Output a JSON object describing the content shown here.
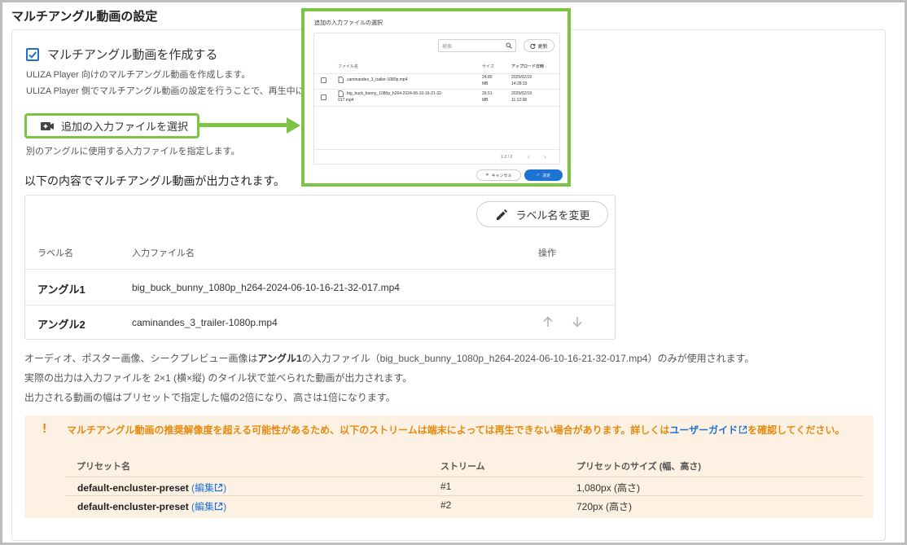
{
  "page": {
    "title": "マルチアングル動画の設定"
  },
  "settings": {
    "checkbox_label": "マルチアングル動画を作成する",
    "checkbox_checked": true,
    "hint1": "ULIZA Player 向けのマルチアングル動画を作成します。",
    "hint2": "ULIZA Player 側でマルチアングル動画の設定を行うことで、再生中に",
    "select_button_label": "追加の入力ファイルを選択",
    "select_hint": "別のアングルに使用する入力ファイルを指定します。",
    "section_title": "以下の内容でマルチアングル動画が出力されます。"
  },
  "angle_table": {
    "rename_button": "ラベル名を変更",
    "headers": {
      "label": "ラベル名",
      "file": "入力ファイル名",
      "action": "操作"
    },
    "rows": [
      {
        "label": "アングル1",
        "file": "big_buck_bunny_1080p_h264-2024-06-10-16-21-32-017.mp4"
      },
      {
        "label": "アングル2",
        "file": "caminandes_3_trailer-1080p.mp4"
      }
    ]
  },
  "notes": {
    "line1_prefix": "オーディオ、ポスター画像、シークプレビュー画像は",
    "line1_bold": "アングル1",
    "line1_suffix": "の入力ファイル（big_buck_bunny_1080p_h264-2024-06-10-16-21-32-017.mp4）のみが使用されます。",
    "line2": "実際の出力は入力ファイルを 2×1 (横×縦) のタイル状で並べられた動画が出力されます。",
    "line3": "出力される動画の幅はプリセットで指定した幅の2倍になり、高さは1倍になります。"
  },
  "warning": {
    "mark": "!",
    "text_before": "マルチアングル動画の推奨解像度を超える可能性があるため、以下のストリームは端末によっては再生できない場合があります。詳しくは",
    "link": "ユーザーガイド",
    "text_after": "を確認してください。",
    "headers": {
      "preset": "プリセット名",
      "stream": "ストリーム",
      "size": "プリセットのサイズ (幅、高さ)"
    },
    "rows": [
      {
        "preset": "default-encluster-preset",
        "edit": "編集",
        "stream": "#1",
        "size": "1,080px (高さ)"
      },
      {
        "preset": "default-encluster-preset",
        "edit": "編集",
        "stream": "#2",
        "size": "720px (高さ)"
      }
    ]
  },
  "dialog": {
    "title": "追加の入力ファイルの選択",
    "search_placeholder": "検索",
    "refresh": "更新",
    "headers": {
      "name": "ファイル名",
      "size": "サイズ",
      "date": "アップロード日時"
    },
    "files": [
      {
        "name": "caminandes_3_trailer-1080p.mp4",
        "name2": "",
        "size": "24.80",
        "size_unit": "MB",
        "date": "2025/02/19",
        "time": "14:28:33"
      },
      {
        "name": "big_buck_bunny_1080p_h264-2024-06-10-16-21-32-",
        "name2": "017.mp4",
        "size": "29.51",
        "size_unit": "MB",
        "date": "2025/02/19",
        "time": "11:12:08"
      }
    ],
    "pagination": "1-2 / 2",
    "cancel": "キャンセル",
    "ok": "決定"
  },
  "colors": {
    "accent": "#1e73d2",
    "highlight": "#7cc444",
    "warning": "#e58a10",
    "warning_bg": "#fdf1e3"
  }
}
